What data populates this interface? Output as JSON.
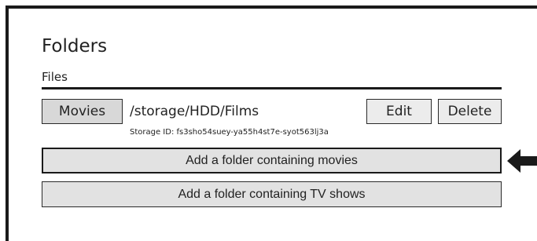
{
  "page": {
    "title": "Folders",
    "subtitle": "Files"
  },
  "folder": {
    "category_label": "Movies",
    "path": "/storage/HDD/Films",
    "storage_id": "Storage ID: fs3sho54suey-ya55h4st7e-syot563lj3a",
    "edit_label": "Edit",
    "delete_label": "Delete"
  },
  "actions": {
    "add_movies_label": "Add a folder containing movies",
    "add_tv_label": "Add a folder containing TV shows"
  },
  "colors": {
    "border": "#1a1a1a",
    "button_bg": "#e2e2e2",
    "text": "#222222"
  },
  "icons": {
    "pointer": "arrow-left-icon"
  }
}
